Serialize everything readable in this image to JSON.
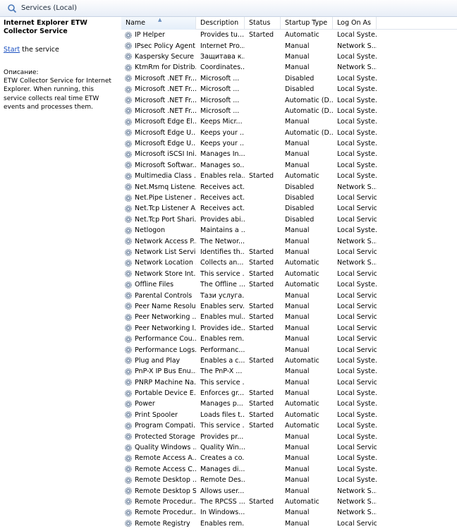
{
  "window": {
    "title": "Services (Local)"
  },
  "left_pane": {
    "service_title": "Internet Explorer ETW Collector Service",
    "start_link": "Start",
    "start_suffix": " the service",
    "description_label": "Описание:",
    "description": "ETW Collector Service for Internet Explorer. When running, this service collects real time ETW events and processes them."
  },
  "columns": {
    "name": "Name",
    "description": "Description",
    "status": "Status",
    "startup_type": "Startup Type",
    "log_on_as": "Log On As"
  },
  "rows": [
    {
      "name": "IP Helper",
      "description": "Provides tu...",
      "status": "Started",
      "startup": "Automatic",
      "logon": "Local Syste..."
    },
    {
      "name": "IPsec Policy Agent",
      "description": "Internet Pro...",
      "status": "",
      "startup": "Manual",
      "logon": "Network S..."
    },
    {
      "name": "Kaspersky Secure ...",
      "description": "Защитава к...",
      "status": "",
      "startup": "Manual",
      "logon": "Local Syste..."
    },
    {
      "name": "KtmRm for Distrib...",
      "description": "Coordinates...",
      "status": "",
      "startup": "Manual",
      "logon": "Network S..."
    },
    {
      "name": "Microsoft .NET Fr...",
      "description": "Microsoft ...",
      "status": "",
      "startup": "Disabled",
      "logon": "Local Syste..."
    },
    {
      "name": "Microsoft .NET Fr...",
      "description": "Microsoft ...",
      "status": "",
      "startup": "Disabled",
      "logon": "Local Syste..."
    },
    {
      "name": "Microsoft .NET Fr...",
      "description": "Microsoft ...",
      "status": "",
      "startup": "Automatic (D...",
      "logon": "Local Syste..."
    },
    {
      "name": "Microsoft .NET Fr...",
      "description": "Microsoft ...",
      "status": "",
      "startup": "Automatic (D...",
      "logon": "Local Syste..."
    },
    {
      "name": "Microsoft Edge El...",
      "description": "Keeps Micr...",
      "status": "",
      "startup": "Manual",
      "logon": "Local Syste..."
    },
    {
      "name": "Microsoft Edge U...",
      "description": "Keeps your ...",
      "status": "",
      "startup": "Automatic (D...",
      "logon": "Local Syste..."
    },
    {
      "name": "Microsoft Edge U...",
      "description": "Keeps your ...",
      "status": "",
      "startup": "Manual",
      "logon": "Local Syste..."
    },
    {
      "name": "Microsoft iSCSI Ini...",
      "description": "Manages In...",
      "status": "",
      "startup": "Manual",
      "logon": "Local Syste..."
    },
    {
      "name": "Microsoft Softwar...",
      "description": "Manages so...",
      "status": "",
      "startup": "Manual",
      "logon": "Local Syste..."
    },
    {
      "name": "Multimedia Class ...",
      "description": "Enables rela...",
      "status": "Started",
      "startup": "Automatic",
      "logon": "Local Syste..."
    },
    {
      "name": "Net.Msmq Listene...",
      "description": "Receives act...",
      "status": "",
      "startup": "Disabled",
      "logon": "Network S..."
    },
    {
      "name": "Net.Pipe Listener ...",
      "description": "Receives act...",
      "status": "",
      "startup": "Disabled",
      "logon": "Local Service"
    },
    {
      "name": "Net.Tcp Listener A...",
      "description": "Receives act...",
      "status": "",
      "startup": "Disabled",
      "logon": "Local Service"
    },
    {
      "name": "Net.Tcp Port Shari...",
      "description": "Provides abi...",
      "status": "",
      "startup": "Disabled",
      "logon": "Local Service"
    },
    {
      "name": "Netlogon",
      "description": "Maintains a ...",
      "status": "",
      "startup": "Manual",
      "logon": "Local Syste..."
    },
    {
      "name": "Network Access P...",
      "description": "The Networ...",
      "status": "",
      "startup": "Manual",
      "logon": "Network S..."
    },
    {
      "name": "Network List Service",
      "description": "Identifies th...",
      "status": "Started",
      "startup": "Manual",
      "logon": "Local Service"
    },
    {
      "name": "Network Location ...",
      "description": "Collects an...",
      "status": "Started",
      "startup": "Automatic",
      "logon": "Network S..."
    },
    {
      "name": "Network Store Int...",
      "description": "This service ...",
      "status": "Started",
      "startup": "Automatic",
      "logon": "Local Service"
    },
    {
      "name": "Offline Files",
      "description": "The Offline ...",
      "status": "Started",
      "startup": "Automatic",
      "logon": "Local Syste..."
    },
    {
      "name": "Parental Controls",
      "description": "Тази услуга...",
      "status": "",
      "startup": "Manual",
      "logon": "Local Service"
    },
    {
      "name": "Peer Name Resolu...",
      "description": "Enables serv...",
      "status": "Started",
      "startup": "Manual",
      "logon": "Local Service"
    },
    {
      "name": "Peer Networking ...",
      "description": "Enables mul...",
      "status": "Started",
      "startup": "Manual",
      "logon": "Local Service"
    },
    {
      "name": "Peer Networking I...",
      "description": "Provides ide...",
      "status": "Started",
      "startup": "Manual",
      "logon": "Local Service"
    },
    {
      "name": "Performance Cou...",
      "description": "Enables rem...",
      "status": "",
      "startup": "Manual",
      "logon": "Local Service"
    },
    {
      "name": "Performance Logs...",
      "description": "Performanc...",
      "status": "",
      "startup": "Manual",
      "logon": "Local Service"
    },
    {
      "name": "Plug and Play",
      "description": "Enables a c...",
      "status": "Started",
      "startup": "Automatic",
      "logon": "Local Syste..."
    },
    {
      "name": "PnP-X IP Bus Enu...",
      "description": "The PnP-X ...",
      "status": "",
      "startup": "Manual",
      "logon": "Local Syste..."
    },
    {
      "name": "PNRP Machine Na...",
      "description": "This service ...",
      "status": "",
      "startup": "Manual",
      "logon": "Local Service"
    },
    {
      "name": "Portable Device E...",
      "description": "Enforces gr...",
      "status": "Started",
      "startup": "Manual",
      "logon": "Local Syste..."
    },
    {
      "name": "Power",
      "description": "Manages p...",
      "status": "Started",
      "startup": "Automatic",
      "logon": "Local Syste..."
    },
    {
      "name": "Print Spooler",
      "description": "Loads files t...",
      "status": "Started",
      "startup": "Automatic",
      "logon": "Local Syste..."
    },
    {
      "name": "Program Compati...",
      "description": "This service ...",
      "status": "Started",
      "startup": "Automatic",
      "logon": "Local Syste..."
    },
    {
      "name": "Protected Storage",
      "description": "Provides pr...",
      "status": "",
      "startup": "Manual",
      "logon": "Local Syste..."
    },
    {
      "name": "Quality Windows ...",
      "description": "Quality Win...",
      "status": "",
      "startup": "Manual",
      "logon": "Local Service"
    },
    {
      "name": "Remote Access A...",
      "description": "Creates a co...",
      "status": "",
      "startup": "Manual",
      "logon": "Local Syste..."
    },
    {
      "name": "Remote Access C...",
      "description": "Manages di...",
      "status": "",
      "startup": "Manual",
      "logon": "Local Syste..."
    },
    {
      "name": "Remote Desktop ...",
      "description": "Remote Des...",
      "status": "",
      "startup": "Manual",
      "logon": "Local Syste..."
    },
    {
      "name": "Remote Desktop S...",
      "description": "Allows user...",
      "status": "",
      "startup": "Manual",
      "logon": "Network S..."
    },
    {
      "name": "Remote Procedur...",
      "description": "The RPCSS ...",
      "status": "Started",
      "startup": "Automatic",
      "logon": "Network S..."
    },
    {
      "name": "Remote Procedur...",
      "description": "In Windows...",
      "status": "",
      "startup": "Manual",
      "logon": "Network S..."
    },
    {
      "name": "Remote Registry",
      "description": "Enables rem...",
      "status": "",
      "startup": "Manual",
      "logon": "Local Service"
    }
  ]
}
